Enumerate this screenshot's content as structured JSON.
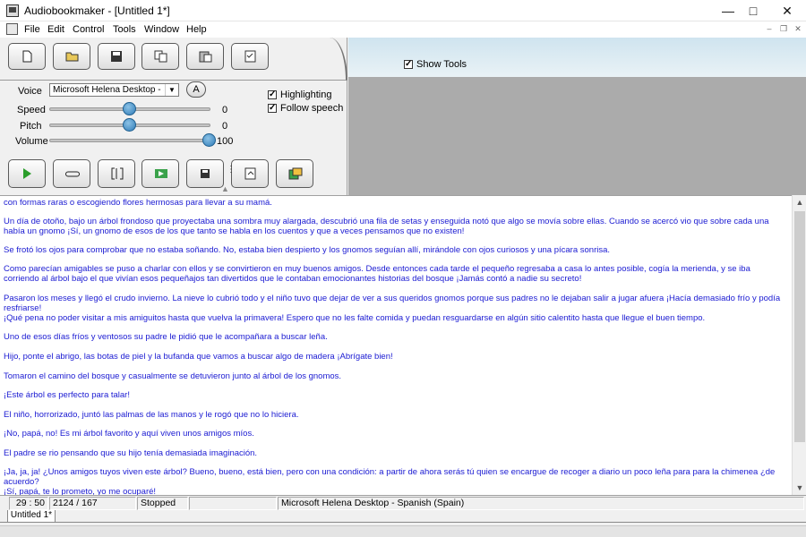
{
  "window": {
    "title": "Audiobookmaker - [Untitled 1*]"
  },
  "menu": {
    "items": [
      "File",
      "Edit",
      "Control",
      "Tools",
      "Window",
      "Help"
    ]
  },
  "toolbar": {
    "buttons": [
      "new-document-icon",
      "open-folder-icon",
      "save-icon",
      "copy-icon",
      "paste-icon",
      "properties-icon"
    ]
  },
  "show_tools": {
    "label": "Show Tools",
    "checked": true
  },
  "voice": {
    "label": "Voice",
    "selected": "Microsoft Helena Desktop - Spanish (Spain)",
    "button_label": "A",
    "speed_label": "Speed",
    "speed_value": "0",
    "speed_level": 0.5,
    "pitch_label": "Pitch",
    "pitch_value": "0",
    "pitch_level": 0.5,
    "volume_label": "Volume",
    "volume_value": "100",
    "volume_level": 1.0
  },
  "options": {
    "highlighting_label": "Highlighting",
    "follow_speech_label": "Follow speech"
  },
  "playback": {
    "buttons": [
      "play-icon",
      "loop-icon",
      "segment-brackets-icon",
      "record-icon",
      "save-audio-icon",
      "export-icon",
      "batch-icon"
    ]
  },
  "text": {
    "paragraphs": [
      "con formas raras o escogiendo flores hermosas para llevar a su mamá.",
      "Un día de otoño, bajo un árbol frondoso que proyectaba una sombra muy alargada, descubrió una fila de setas y enseguida notó que algo se movía sobre ellas. Cuando se acercó vio que sobre cada una había un gnomo ¡Sí, un gnomo de esos de los que tanto se habla en los cuentos y que a veces pensamos que no existen!",
      "Se frotó los ojos para comprobar que no estaba soñando. No, estaba bien despierto y los gnomos seguían allí, mirándole con ojos curiosos y una pícara sonrisa.",
      "Como parecían amigables se puso a charlar con ellos y se convirtieron en muy buenos amigos. Desde entonces cada tarde el pequeño regresaba a casa lo antes posible, cogía la merienda, y se iba corriendo al árbol bajo el que vivían esos pequeñajos tan divertidos que le contaban emocionantes historias del bosque ¡Jamás contó a nadie su secreto!",
      "Pasaron los meses y llegó el crudo invierno. La nieve lo cubrió todo y el niño tuvo que dejar de ver a sus queridos gnomos porque sus padres no le dejaban salir a jugar afuera ¡Hacía demasiado frío y podía resfriarse!",
      "¡Qué pena no poder  visitar a mis amiguitos hasta que vuelva la primavera! Espero que no les falte comida y puedan resguardarse en algún sitio calentito hasta que llegue el buen tiempo.",
      "Uno de esos días fríos y ventosos su padre le pidió que le acompañara a buscar leña.",
      "Hijo, ponte el abrigo, las botas de piel y la bufanda que vamos a buscar algo de madera ¡Abrígate bien!",
      "Tomaron el camino del bosque y casualmente se detuvieron junto al árbol de los gnomos.",
      "¡Este árbol es perfecto para talar!",
      "El niño, horrorizado, juntó las palmas de las manos y le rogó que no lo hiciera.",
      "¡No, papá, no! Es mi árbol favorito y aquí viven unos amigos míos.",
      "El padre se rio pensando que su hijo tenía demasiada imaginación.",
      "¡Ja, ja, ja! ¿Unos amigos tuyos viven este árbol? Bueno, bueno, está bien, pero con una condición: a partir de ahora serás tú quien se encargue de recoger  a diario un poco leña para para la chimenea ¿de acuerdo?",
      "¡Sí, papá, te lo prometo, yo me ocuparé!"
    ]
  },
  "status": {
    "time": "29 : 50",
    "position": "2124 / 167",
    "state": "Stopped",
    "voice": "Microsoft Helena Desktop - Spanish (Spain)"
  },
  "tabs": {
    "document": "Untitled 1*"
  }
}
